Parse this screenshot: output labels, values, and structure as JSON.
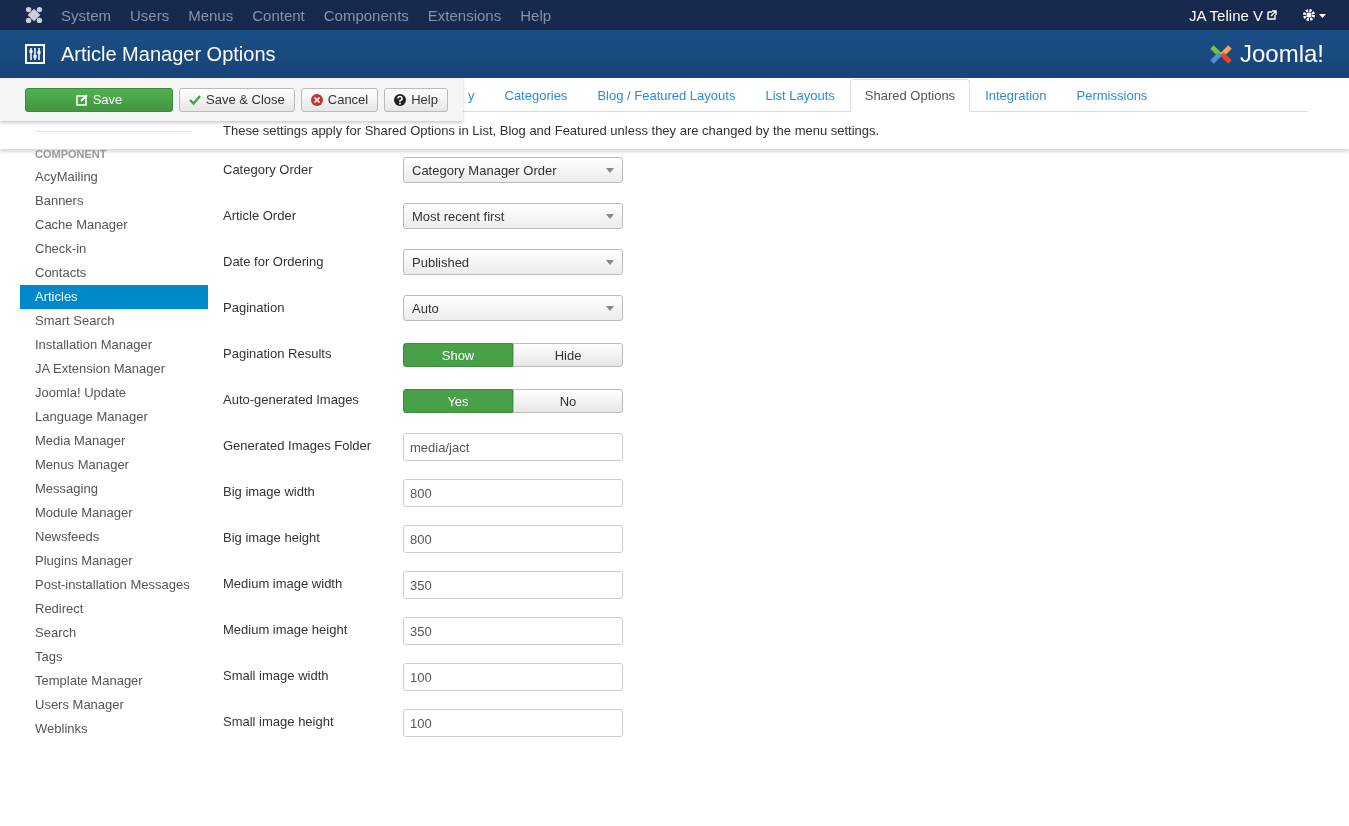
{
  "menu_bar": {
    "items": [
      "System",
      "Users",
      "Menus",
      "Content",
      "Components",
      "Extensions",
      "Help"
    ],
    "site_link": "JA Teline V"
  },
  "header": {
    "title": "Article Manager Options",
    "logo_text": "Joomla!"
  },
  "toolbar": {
    "buttons": [
      {
        "label": "Save",
        "kind": "save"
      },
      {
        "label": "Save & Close",
        "kind": "check"
      },
      {
        "label": "Cancel",
        "kind": "cancel"
      },
      {
        "label": "Help",
        "kind": "help"
      }
    ]
  },
  "tabs": [
    {
      "label": "y",
      "selected": false
    },
    {
      "label": "Categories",
      "selected": false
    },
    {
      "label": "Blog / Featured Layouts",
      "selected": false
    },
    {
      "label": "List Layouts",
      "selected": false
    },
    {
      "label": "Shared Options",
      "selected": true
    },
    {
      "label": "Integration",
      "selected": false
    },
    {
      "label": "Permissions",
      "selected": false
    }
  ],
  "sidebar": {
    "heading": "COMPONENT",
    "items": [
      {
        "label": "AcyMailing",
        "selected": false
      },
      {
        "label": "Banners",
        "selected": false
      },
      {
        "label": "Cache Manager",
        "selected": false
      },
      {
        "label": "Check-in",
        "selected": false
      },
      {
        "label": "Contacts",
        "selected": false
      },
      {
        "label": "Articles",
        "selected": true
      },
      {
        "label": "Smart Search",
        "selected": false
      },
      {
        "label": "Installation Manager",
        "selected": false
      },
      {
        "label": "JA Extension Manager",
        "selected": false
      },
      {
        "label": "Joomla! Update",
        "selected": false
      },
      {
        "label": "Language Manager",
        "selected": false
      },
      {
        "label": "Media Manager",
        "selected": false
      },
      {
        "label": "Menus Manager",
        "selected": false
      },
      {
        "label": "Messaging",
        "selected": false
      },
      {
        "label": "Module Manager",
        "selected": false
      },
      {
        "label": "Newsfeeds",
        "selected": false
      },
      {
        "label": "Plugins Manager",
        "selected": false
      },
      {
        "label": "Post-installation Messages",
        "selected": false
      },
      {
        "label": "Redirect",
        "selected": false
      },
      {
        "label": "Search",
        "selected": false
      },
      {
        "label": "Tags",
        "selected": false
      },
      {
        "label": "Template Manager",
        "selected": false
      },
      {
        "label": "Users Manager",
        "selected": false
      },
      {
        "label": "Weblinks",
        "selected": false
      }
    ]
  },
  "description": "These settings apply for Shared Options in List, Blog and Featured unless they are changed by the menu settings.",
  "fields": [
    {
      "label": "Category Order",
      "kind": "select",
      "value": "Category Manager Order"
    },
    {
      "label": "Article Order",
      "kind": "select",
      "value": "Most recent first"
    },
    {
      "label": "Date for Ordering",
      "kind": "select",
      "value": "Published"
    },
    {
      "label": "Pagination",
      "kind": "select",
      "value": "Auto"
    },
    {
      "label": "Pagination Results",
      "kind": "toggle",
      "options": [
        {
          "label": "Show",
          "selected": true
        },
        {
          "label": "Hide",
          "selected": false
        }
      ]
    },
    {
      "label": "Auto-generated Images",
      "kind": "toggle",
      "options": [
        {
          "label": "Yes",
          "selected": true
        },
        {
          "label": "No",
          "selected": false
        }
      ]
    },
    {
      "label": "Generated Images Folder",
      "kind": "text",
      "value": "media/jact"
    },
    {
      "label": "Big image width",
      "kind": "text",
      "value": "800"
    },
    {
      "label": "Big image height",
      "kind": "text",
      "value": "800"
    },
    {
      "label": "Medium image width",
      "kind": "text",
      "value": "350"
    },
    {
      "label": "Medium image height",
      "kind": "text",
      "value": "350"
    },
    {
      "label": "Small image width",
      "kind": "text",
      "value": "100"
    },
    {
      "label": "Small image height",
      "kind": "text",
      "value": "100"
    }
  ]
}
